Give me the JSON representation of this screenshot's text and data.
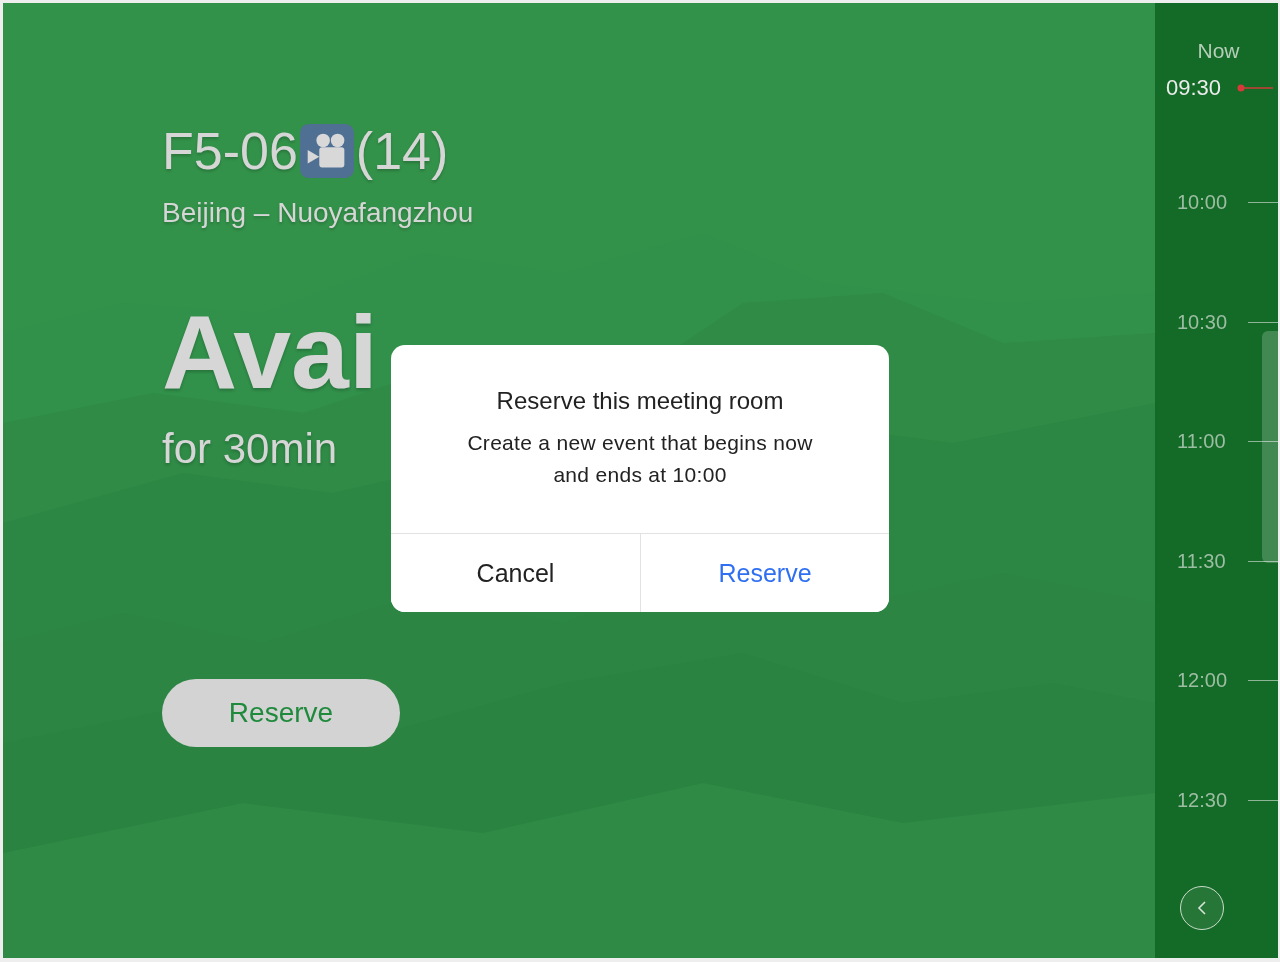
{
  "room": {
    "name": "F5-06",
    "capacity": "(14)",
    "location": "Beijing – Nuoyafangzhou"
  },
  "status": {
    "label": "Avai",
    "duration": "for 30min"
  },
  "reserve_button": {
    "label": "Reserve"
  },
  "timeline": {
    "now_label": "Now",
    "now_time": "09:30",
    "times": [
      "10:00",
      "10:30",
      "11:00",
      "11:30",
      "12:00",
      "12:30"
    ]
  },
  "dialog": {
    "title": "Reserve this meeting room",
    "message": "Create a new event that begins now and ends at 10:00",
    "buttons": [
      {
        "label": "Cancel",
        "kind": "cancel"
      },
      {
        "label": "Reserve",
        "kind": "confirm"
      }
    ]
  }
}
